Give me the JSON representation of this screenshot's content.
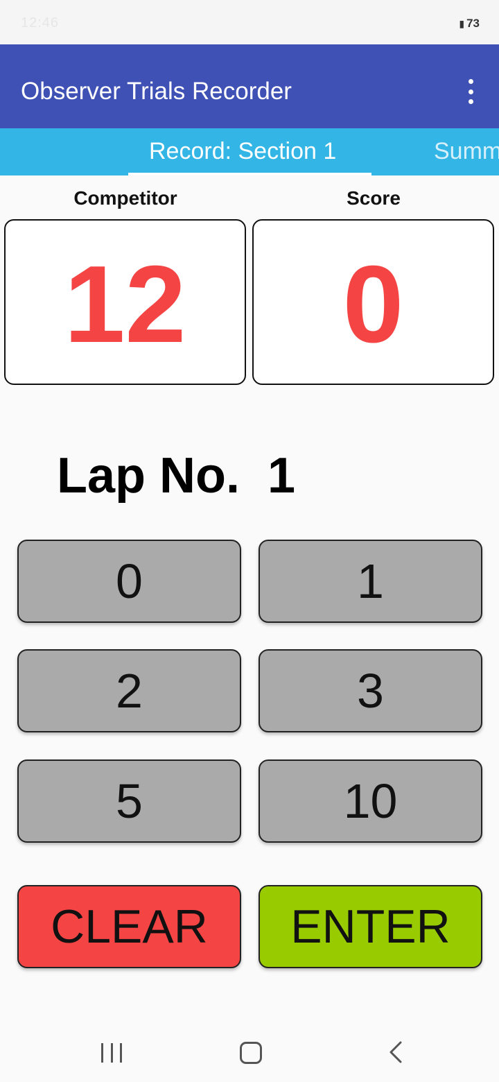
{
  "status_bar": {
    "left_text": "12:46",
    "battery": "73"
  },
  "app_bar": {
    "title": "Observer Trials Recorder"
  },
  "tabs": [
    {
      "label": "Record: Section 1",
      "selected": true
    },
    {
      "label": "Summ",
      "selected": false
    }
  ],
  "competitor": {
    "label": "Competitor",
    "value": "12"
  },
  "score": {
    "label": "Score",
    "value": "0"
  },
  "lap": {
    "text": "Lap No.  1"
  },
  "keypad": {
    "keys": [
      "0",
      "1",
      "2",
      "3",
      "5",
      "10"
    ],
    "clear_label": "CLEAR",
    "enter_label": "ENTER"
  },
  "colors": {
    "app_bar": "#3f51b5",
    "tab_bar": "#33b5e5",
    "value_red": "#f44444",
    "key_grey": "#aaaaaa",
    "clear_red": "#f44444",
    "enter_green": "#99cc00"
  },
  "icons": {
    "overflow": "more-vert-icon",
    "battery": "battery-icon",
    "nav_recents": "recents-icon",
    "nav_home": "home-icon",
    "nav_back": "back-icon"
  }
}
